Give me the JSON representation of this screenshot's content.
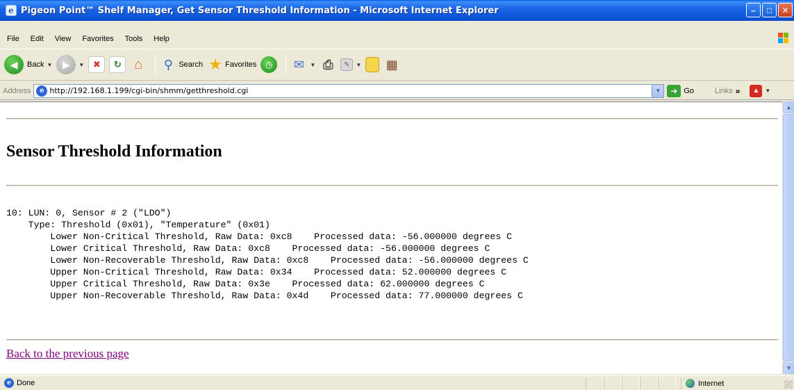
{
  "window": {
    "title": "Pigeon Point™ Shelf Manager, Get Sensor Threshold Information - Microsoft Internet Explorer"
  },
  "menu": [
    "File",
    "Edit",
    "View",
    "Favorites",
    "Tools",
    "Help"
  ],
  "toolbar": {
    "back_label": "Back",
    "search_label": "Search",
    "favorites_label": "Favorites"
  },
  "address": {
    "label": "Address",
    "url": "http://192.168.1.199/cgi-bin/shmm/getthreshold.cgi",
    "go_label": "Go",
    "links_label": "Links"
  },
  "page": {
    "heading": "Sensor Threshold Information",
    "lines": [
      "10: LUN: 0, Sensor # 2 (\"LDO\")",
      "    Type: Threshold (0x01), \"Temperature\" (0x01)",
      "        Lower Non-Critical Threshold, Raw Data: 0xc8    Processed data: -56.000000 degrees C",
      "        Lower Critical Threshold, Raw Data: 0xc8    Processed data: -56.000000 degrees C",
      "        Lower Non-Recoverable Threshold, Raw Data: 0xc8    Processed data: -56.000000 degrees C",
      "        Upper Non-Critical Threshold, Raw Data: 0x34    Processed data: 52.000000 degrees C",
      "        Upper Critical Threshold, Raw Data: 0x3e    Processed data: 62.000000 degrees C",
      "        Upper Non-Recoverable Threshold, Raw Data: 0x4d    Processed data: 77.000000 degrees C"
    ],
    "back_link": "Back to the previous page"
  },
  "status": {
    "text": "Done",
    "zone": "Internet"
  }
}
